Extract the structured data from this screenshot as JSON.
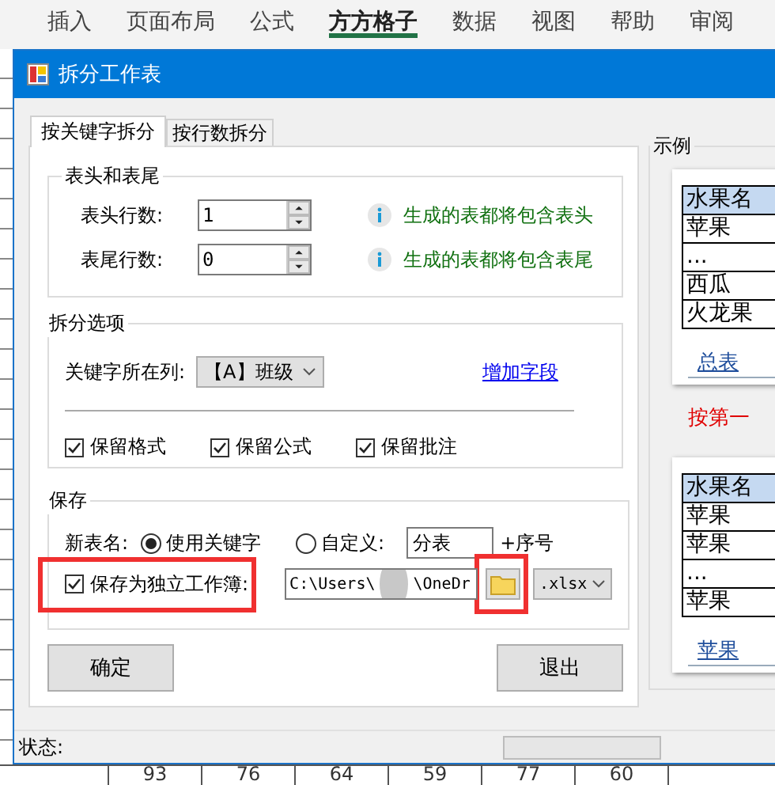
{
  "ribbon": {
    "tabs": [
      {
        "label": "插入",
        "selected": false
      },
      {
        "label": "页面布局",
        "selected": false
      },
      {
        "label": "公式",
        "selected": false
      },
      {
        "label": "方方格子",
        "selected": true
      },
      {
        "label": "数据",
        "selected": false
      },
      {
        "label": "视图",
        "selected": false
      },
      {
        "label": "帮助",
        "selected": false
      },
      {
        "label": "审阅",
        "selected": false
      }
    ]
  },
  "dialog": {
    "title": "拆分工作表",
    "tabs": [
      {
        "label": "按关键字拆分",
        "selected": true
      },
      {
        "label": "按行数拆分",
        "selected": false
      }
    ],
    "header_footer": {
      "title": "表头和表尾",
      "rows": [
        {
          "label": "表头行数:",
          "value": "1",
          "hint": "生成的表都将包含表头"
        },
        {
          "label": "表尾行数:",
          "value": "0",
          "hint": "生成的表都将包含表尾"
        }
      ]
    },
    "split_options": {
      "title": "拆分选项",
      "key_column_label": "关键字所在列:",
      "key_column": "【A】班级",
      "add_field_link": "增加字段",
      "checkboxes": [
        {
          "label": "保留格式",
          "checked": true
        },
        {
          "label": "保留公式",
          "checked": true
        },
        {
          "label": "保留批注",
          "checked": true
        }
      ]
    },
    "save": {
      "title": "保存",
      "new_name_label": "新表名:",
      "name_options": [
        {
          "label": "使用关键字",
          "selected": true
        },
        {
          "label": "自定义:",
          "selected": false
        }
      ],
      "custom_name": "分表",
      "suffix": "+序号",
      "separate_workbook": {
        "label": "保存为独立工作簿:",
        "checked": true
      },
      "path_start": "C:\\Users\\",
      "path_end": "\\OneDr",
      "extension": ".xlsx"
    },
    "buttons": [
      "确定",
      "退出"
    ],
    "example": {
      "title": "示例",
      "caption": "按第一",
      "samples": [
        {
          "header": "水果名",
          "rows": [
            "苹果",
            "...",
            "西瓜",
            "火龙果"
          ],
          "sheet_tab": "总表"
        },
        {
          "header": "水果名",
          "rows": [
            "苹果",
            "苹果",
            "...",
            "苹果"
          ],
          "sheet_tab": "苹果"
        }
      ]
    },
    "status_label": "状态:",
    "progress": {
      "level": 0
    }
  },
  "sheet": {
    "bottom_row": [
      "93",
      "76",
      "64",
      "59",
      "77",
      "60"
    ]
  }
}
